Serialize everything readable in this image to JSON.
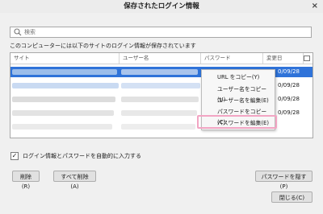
{
  "window": {
    "title": "保存されたログイン情報",
    "close_glyph": "×"
  },
  "search": {
    "placeholder": "検索"
  },
  "description": "このコンピューターには以下のサイトのログイン情報が保存されています",
  "table": {
    "columns": [
      "サイト",
      "ユーザー名",
      "パスワード",
      "変更日"
    ],
    "rows": [
      {
        "date": "0/09/28",
        "selected": true
      },
      {
        "date": "0/09/28",
        "selected": false
      },
      {
        "date": "0/09/28",
        "selected": false
      },
      {
        "date": "0/09/28",
        "selected": false
      },
      {
        "date": "",
        "selected": false
      }
    ]
  },
  "context_menu": {
    "items": [
      "URL をコピー(Y)",
      "ユーザー名をコピー(U)",
      "ユーザー名を編集(E)",
      "パスワードをコピー(C)",
      "パスワードを編集(E)"
    ],
    "highlighted_index": 4
  },
  "autofill": {
    "label": "ログイン情報とパスワードを自動的に入力する",
    "checked": true,
    "check_glyph": "✓"
  },
  "buttons": {
    "delete": "削除(R)",
    "delete_all": "すべて削除(A)",
    "hide_passwords": "パスワードを隠す(P)",
    "close": "閉じる(C)"
  },
  "colors": {
    "selection": "#2f73d9",
    "highlight_box": "#f2a5c3",
    "blur_light": "#c9daf2",
    "blur_dark": "#a9c4ec"
  }
}
